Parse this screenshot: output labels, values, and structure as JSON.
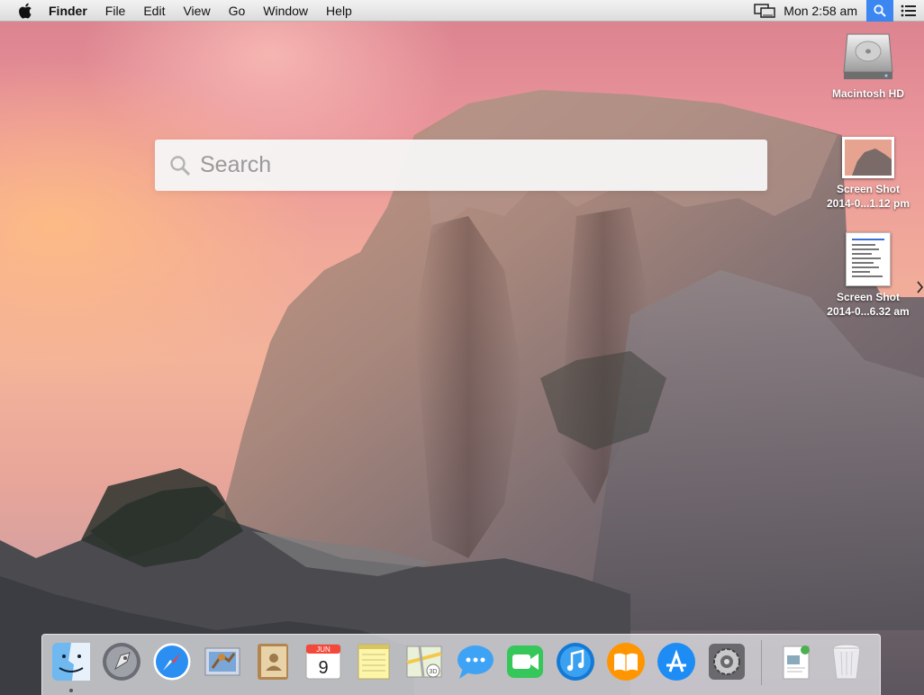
{
  "menubar": {
    "app_name": "Finder",
    "menus": [
      "File",
      "Edit",
      "View",
      "Go",
      "Window",
      "Help"
    ],
    "clock": "Mon 2:58 am"
  },
  "spotlight": {
    "placeholder": "Search"
  },
  "desktop": {
    "icons": [
      {
        "label": "Macintosh HD",
        "icon": "hard-drive-icon"
      },
      {
        "label_line1": "Screen Shot",
        "label_line2": "2014-0...1.12 pm",
        "icon": "screenshot-thumbnail"
      },
      {
        "label_line1": "Screen Shot",
        "label_line2": "2014-0...6.32 am",
        "icon": "screenshot-thumbnail"
      }
    ]
  },
  "dock": {
    "apps": [
      {
        "name": "Finder",
        "icon": "finder-icon",
        "running": true
      },
      {
        "name": "Launchpad",
        "icon": "launchpad-icon"
      },
      {
        "name": "Safari",
        "icon": "safari-icon"
      },
      {
        "name": "Mail",
        "icon": "mail-icon"
      },
      {
        "name": "Contacts",
        "icon": "contacts-icon"
      },
      {
        "name": "Calendar",
        "icon": "calendar-icon",
        "month": "JUN",
        "day": "9"
      },
      {
        "name": "Notes",
        "icon": "notes-icon"
      },
      {
        "name": "Maps",
        "icon": "maps-icon"
      },
      {
        "name": "Messages",
        "icon": "messages-icon"
      },
      {
        "name": "FaceTime",
        "icon": "facetime-icon"
      },
      {
        "name": "iTunes",
        "icon": "itunes-icon"
      },
      {
        "name": "iBooks",
        "icon": "ibooks-icon"
      },
      {
        "name": "App Store",
        "icon": "app-store-icon"
      },
      {
        "name": "System Preferences",
        "icon": "system-preferences-icon"
      }
    ],
    "right": [
      {
        "name": "Downloads",
        "icon": "downloads-stack-icon"
      },
      {
        "name": "Trash",
        "icon": "trash-icon"
      }
    ]
  },
  "colors": {
    "spotlight_accent": "#3c86f1",
    "menubar": "#e6e6e6"
  }
}
